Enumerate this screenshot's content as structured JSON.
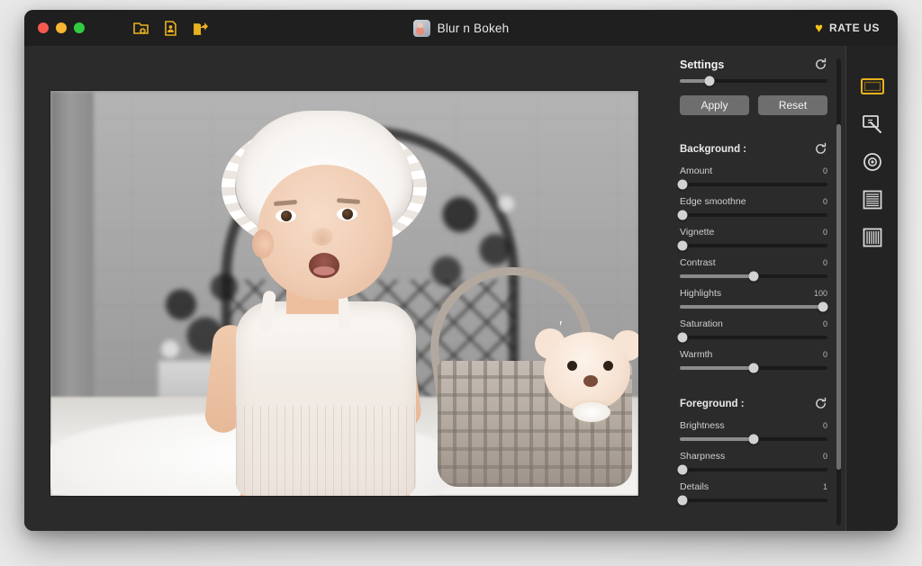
{
  "window": {
    "title": "Blur n Bokeh",
    "app_icon": "baby-photo-app-icon",
    "traffic_lights": [
      {
        "name": "close",
        "color": "#f5594e"
      },
      {
        "name": "minimize",
        "color": "#f7b731"
      },
      {
        "name": "zoom",
        "color": "#30cd40"
      }
    ]
  },
  "toolbar": {
    "items": [
      {
        "name": "open-image-icon",
        "label": "Open Image",
        "color": "#e8b21f"
      },
      {
        "name": "save-document-icon",
        "label": "Save",
        "color": "#e8b21f"
      },
      {
        "name": "share-export-icon",
        "label": "Share",
        "color": "#e8b21f"
      }
    ],
    "rate_us": {
      "label": "RATE US",
      "icon": "heart-icon",
      "icon_glyph": "♥",
      "color": "#f5c518"
    }
  },
  "canvas": {
    "name": "photo-canvas",
    "description": "Photo of a baby wearing a white lace bonnet sitting on a rug with a teddy bear in a wicker basket; background is desaturated and blurred"
  },
  "panel": {
    "settings": {
      "title": "Settings",
      "reset_icon": "refresh-icon",
      "master_slider": {
        "name": "settings-master-slider",
        "percent": 20
      },
      "apply_label": "Apply",
      "reset_label": "Reset"
    },
    "background": {
      "title": "Background :",
      "reset_icon": "refresh-icon",
      "sliders": [
        {
          "label": "Amount",
          "value": "0",
          "percent": 2
        },
        {
          "label": "Edge smoothne",
          "value": "0",
          "percent": 2
        },
        {
          "label": "Vignette",
          "value": "0",
          "percent": 2
        },
        {
          "label": "Contrast",
          "value": "0",
          "percent": 50
        },
        {
          "label": "Highlights",
          "value": "100",
          "percent": 97
        },
        {
          "label": "Saturation",
          "value": "0",
          "percent": 2
        },
        {
          "label": "Warmth",
          "value": "0",
          "percent": 50
        }
      ]
    },
    "foreground": {
      "title": "Foreground :",
      "reset_icon": "refresh-icon",
      "sliders": [
        {
          "label": "Brightness",
          "value": "0",
          "percent": 50
        },
        {
          "label": "Sharpness",
          "value": "0",
          "percent": 2
        },
        {
          "label": "Details",
          "value": "1",
          "percent": 2
        }
      ]
    },
    "scrollbar": {
      "name": "panel-scrollbar",
      "thumb_top_percent": 14,
      "thumb_height_percent": 74
    }
  },
  "rail": {
    "tools": [
      {
        "name": "rect-blur-tool",
        "label": "Rectangular Blur",
        "active": true,
        "color": "#e8b21f"
      },
      {
        "name": "freehand-blur-tool",
        "label": "Freehand Blur",
        "active": false,
        "color": "#d8d8d8"
      },
      {
        "name": "radial-blur-tool",
        "label": "Radial Blur",
        "active": false,
        "color": "#d8d8d8"
      },
      {
        "name": "linear-blur-tool",
        "label": "Linear Blur",
        "active": false,
        "color": "#d8d8d8"
      },
      {
        "name": "motion-blur-tool",
        "label": "Motion Blur",
        "active": false,
        "color": "#d8d8d8"
      }
    ]
  }
}
